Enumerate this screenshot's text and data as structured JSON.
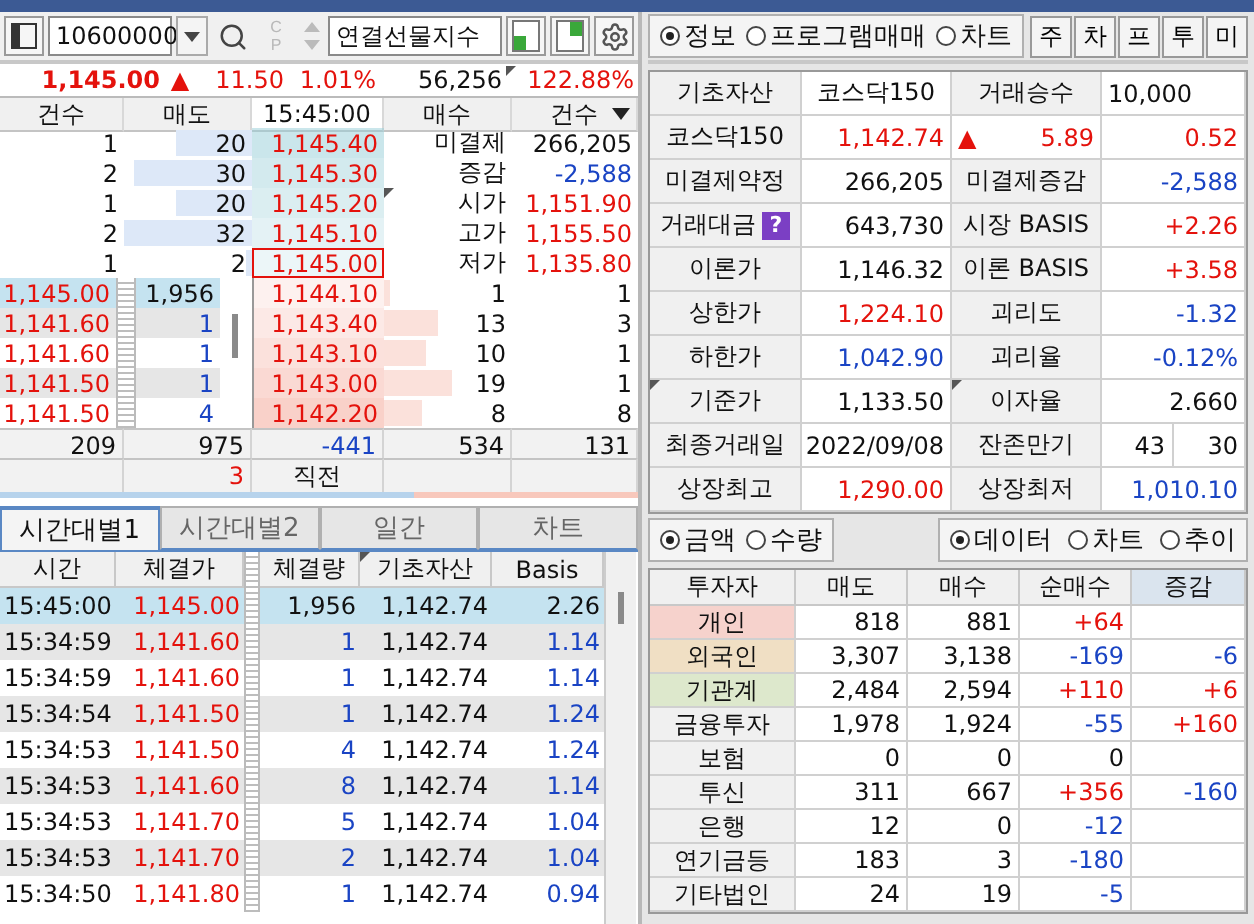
{
  "toolbar": {
    "code": "10600000",
    "cp": {
      "top": "C",
      "bottom": "P",
      "disabled": true
    },
    "name": "연결선물지수"
  },
  "mode_tabs": [
    {
      "label": "정보",
      "selected": true
    },
    {
      "label": "프로그램매매",
      "selected": false
    },
    {
      "label": "차트",
      "selected": false
    }
  ],
  "shortcuts": [
    "주",
    "차",
    "프",
    "투",
    "미"
  ],
  "quote": {
    "price": "1,145.00",
    "arrow": "▲",
    "change": "11.50",
    "rate": "1.01%",
    "color": "#e4120c",
    "volume": "56,256",
    "volume_flagged": true,
    "ratio": "122.88%"
  },
  "orderbook": {
    "columns": [
      "건수",
      "매도",
      "15:45:00",
      "매수",
      "건수"
    ],
    "asks": [
      {
        "count": "1",
        "qty": "20",
        "price": "1,145.40",
        "level": 0.6,
        "current": false
      },
      {
        "count": "2",
        "qty": "30",
        "price": "1,145.30",
        "level": 0.92,
        "current": false
      },
      {
        "count": "1",
        "qty": "20",
        "price": "1,145.20",
        "level": 0.6,
        "current": false
      },
      {
        "count": "2",
        "qty": "32",
        "price": "1,145.10",
        "level": 1,
        "current": false
      },
      {
        "count": "1",
        "qty": "2",
        "price": "1,145.00",
        "level": 0.05,
        "current": true
      }
    ],
    "stats": [
      {
        "label": "미결제",
        "value": "266,205",
        "color": "#111111",
        "flagged": false
      },
      {
        "label": "증감",
        "value": "-2,588",
        "color": "#1a44c4",
        "flagged": false
      },
      {
        "label": "시가",
        "value": "1,151.90",
        "color": "#e4120c",
        "flagged": true
      },
      {
        "label": "고가",
        "value": "1,155.50",
        "color": "#e4120c",
        "flagged": false
      },
      {
        "label": "저가",
        "value": "1,135.80",
        "color": "#e4120c",
        "flagged": false
      }
    ],
    "ticks": [
      {
        "price": "1,145.00",
        "qty": "1,956",
        "color": "#111111",
        "selected": true
      },
      {
        "price": "1,141.60",
        "qty": "1",
        "color": "#1a44c4",
        "selected": false
      },
      {
        "price": "1,141.60",
        "qty": "1",
        "color": "#1a44c4",
        "selected": false
      },
      {
        "price": "1,141.50",
        "qty": "1",
        "color": "#1a44c4",
        "selected": false
      },
      {
        "price": "1,141.50",
        "qty": "4",
        "color": "#1a44c4",
        "selected": false
      }
    ],
    "bids": [
      {
        "price": "1,144.10",
        "qty": "1",
        "count": "1",
        "level": 0.04
      },
      {
        "price": "1,143.40",
        "qty": "13",
        "count": "3",
        "level": 0.42
      },
      {
        "price": "1,143.10",
        "qty": "10",
        "count": "1",
        "level": 0.33
      },
      {
        "price": "1,143.00",
        "qty": "19",
        "count": "1",
        "level": 0.53
      },
      {
        "price": "1,142.20",
        "qty": "8",
        "count": "8",
        "level": 0.3
      }
    ],
    "totals": [
      {
        "text": "209",
        "color": "#111111"
      },
      {
        "text": "975",
        "color": "#111111"
      },
      {
        "text": "-441",
        "color": "#1a44c4"
      },
      {
        "text": "534",
        "color": "#111111"
      },
      {
        "text": "131",
        "color": "#111111"
      }
    ],
    "footer": {
      "count": "3",
      "label": "직전"
    }
  },
  "strength": {
    "level": 0.65
  },
  "info": [
    {
      "cells": [
        {
          "kind": "label",
          "text": "기초자산",
          "flagged": false
        },
        {
          "kind": "value",
          "text": "코스닥150",
          "color": "#111111"
        },
        {
          "kind": "label",
          "text": "거래승수",
          "flagged": false
        },
        {
          "kind": "value",
          "text": "10,000",
          "color": "#111111"
        }
      ]
    },
    {
      "cells": [
        {
          "kind": "label",
          "text": "코스닥150",
          "flagged": false
        },
        {
          "kind": "value",
          "text": "1,142.74",
          "color": "#e4120c"
        },
        {
          "kind": "value",
          "arrow": "▲",
          "text": "5.89",
          "color": "#e4120c"
        },
        {
          "kind": "value",
          "text": "0.52",
          "color": "#e4120c"
        }
      ]
    },
    {
      "cells": [
        {
          "kind": "label",
          "text": "미결제약정",
          "flagged": false
        },
        {
          "kind": "value",
          "text": "266,205",
          "color": "#111111"
        },
        {
          "kind": "label",
          "text": "미결제증감",
          "flagged": false
        },
        {
          "kind": "value",
          "text": "-2,588",
          "color": "#1a44c4"
        }
      ]
    },
    {
      "cells": [
        {
          "kind": "label",
          "text": "거래대금",
          "help": "?",
          "flagged": false
        },
        {
          "kind": "value",
          "text": "643,730",
          "color": "#111111"
        },
        {
          "kind": "label",
          "text": "시장 BASIS",
          "flagged": false
        },
        {
          "kind": "value",
          "text": "+2.26",
          "color": "#e4120c"
        }
      ]
    },
    {
      "cells": [
        {
          "kind": "label",
          "text": "이론가",
          "flagged": false
        },
        {
          "kind": "value",
          "text": "1,146.32",
          "color": "#111111"
        },
        {
          "kind": "label",
          "text": "이론 BASIS",
          "flagged": false
        },
        {
          "kind": "value",
          "text": "+3.58",
          "color": "#e4120c"
        }
      ]
    },
    {
      "cells": [
        {
          "kind": "label",
          "text": "상한가",
          "flagged": false
        },
        {
          "kind": "value",
          "text": "1,224.10",
          "color": "#e4120c"
        },
        {
          "kind": "label",
          "text": "괴리도",
          "flagged": false
        },
        {
          "kind": "value",
          "text": "-1.32",
          "color": "#1a44c4"
        }
      ]
    },
    {
      "cells": [
        {
          "kind": "label",
          "text": "하한가",
          "flagged": false
        },
        {
          "kind": "value",
          "text": "1,042.90",
          "color": "#1a44c4"
        },
        {
          "kind": "label",
          "text": "괴리율",
          "flagged": false
        },
        {
          "kind": "value",
          "text": "-0.12%",
          "color": "#1a44c4"
        }
      ]
    },
    {
      "cells": [
        {
          "kind": "label",
          "text": "기준가",
          "flagged": true
        },
        {
          "kind": "value",
          "text": "1,133.50",
          "color": "#111111"
        },
        {
          "kind": "label",
          "text": "이자율",
          "flagged": true
        },
        {
          "kind": "value",
          "text": "2.660",
          "color": "#111111"
        }
      ]
    },
    {
      "cells": [
        {
          "kind": "label",
          "text": "최종거래일",
          "flagged": false
        },
        {
          "kind": "value",
          "text": "2022/09/08",
          "color": "#111111"
        },
        {
          "kind": "label",
          "text": "잔존만기",
          "flagged": false
        },
        {
          "kind": "split",
          "parts": [
            "43",
            "30"
          ]
        }
      ]
    },
    {
      "cells": [
        {
          "kind": "label",
          "text": "상장최고",
          "flagged": false
        },
        {
          "kind": "value",
          "text": "1,290.00",
          "color": "#e4120c"
        },
        {
          "kind": "label",
          "text": "상장최저",
          "flagged": false
        },
        {
          "kind": "value",
          "text": "1,010.10",
          "color": "#1a44c4"
        }
      ]
    }
  ],
  "trade_tabs": [
    {
      "label": "시간대별1",
      "selected": true
    },
    {
      "label": "시간대별2",
      "selected": false
    },
    {
      "label": "일간",
      "selected": false
    },
    {
      "label": "차트",
      "selected": false
    }
  ],
  "trades": {
    "columns": [
      {
        "label": "시간",
        "flagged": false
      },
      {
        "label": "체결가",
        "flagged": false
      },
      {
        "label": "체결량",
        "flagged": false
      },
      {
        "label": "기초자산",
        "flagged": true
      },
      {
        "label": "Basis",
        "flagged": false
      }
    ],
    "rows": [
      {
        "time": "15:45:00",
        "price": "1,145.00",
        "qty": {
          "text": "1,956",
          "color": "#111111"
        },
        "base": "1,142.74",
        "basis": {
          "text": "2.26",
          "color": "#111111"
        },
        "selected": true
      },
      {
        "time": "15:34:59",
        "price": "1,141.60",
        "qty": {
          "text": "1",
          "color": "#1a44c4"
        },
        "base": "1,142.74",
        "basis": {
          "text": "1.14",
          "color": "#1a44c4"
        },
        "selected": false
      },
      {
        "time": "15:34:59",
        "price": "1,141.60",
        "qty": {
          "text": "1",
          "color": "#1a44c4"
        },
        "base": "1,142.74",
        "basis": {
          "text": "1.14",
          "color": "#1a44c4"
        },
        "selected": false
      },
      {
        "time": "15:34:54",
        "price": "1,141.50",
        "qty": {
          "text": "1",
          "color": "#1a44c4"
        },
        "base": "1,142.74",
        "basis": {
          "text": "1.24",
          "color": "#1a44c4"
        },
        "selected": false
      },
      {
        "time": "15:34:53",
        "price": "1,141.50",
        "qty": {
          "text": "4",
          "color": "#1a44c4"
        },
        "base": "1,142.74",
        "basis": {
          "text": "1.24",
          "color": "#1a44c4"
        },
        "selected": false
      },
      {
        "time": "15:34:53",
        "price": "1,141.60",
        "qty": {
          "text": "8",
          "color": "#1a44c4"
        },
        "base": "1,142.74",
        "basis": {
          "text": "1.14",
          "color": "#1a44c4"
        },
        "selected": false
      },
      {
        "time": "15:34:53",
        "price": "1,141.70",
        "qty": {
          "text": "5",
          "color": "#1a44c4"
        },
        "base": "1,142.74",
        "basis": {
          "text": "1.04",
          "color": "#1a44c4"
        },
        "selected": false
      },
      {
        "time": "15:34:53",
        "price": "1,141.70",
        "qty": {
          "text": "2",
          "color": "#1a44c4"
        },
        "base": "1,142.74",
        "basis": {
          "text": "1.04",
          "color": "#1a44c4"
        },
        "selected": false
      },
      {
        "time": "15:34:50",
        "price": "1,141.80",
        "qty": {
          "text": "1",
          "color": "#1a44c4"
        },
        "base": "1,142.74",
        "basis": {
          "text": "0.94",
          "color": "#1a44c4"
        },
        "selected": false
      }
    ]
  },
  "unit_options": [
    {
      "label": "금액",
      "selected": true
    },
    {
      "label": "수량",
      "selected": false
    }
  ],
  "view_options": [
    {
      "label": "데이터",
      "selected": true
    },
    {
      "label": "차트",
      "selected": false
    },
    {
      "label": "추이",
      "selected": false
    }
  ],
  "investors": {
    "columns": [
      {
        "label": "투자자",
        "selected": false
      },
      {
        "label": "매도",
        "selected": false
      },
      {
        "label": "매수",
        "selected": false
      },
      {
        "label": "순매수",
        "selected": false
      },
      {
        "label": "증감",
        "selected": true
      }
    ],
    "rows": [
      {
        "name": "개인",
        "color": "#f6d2cc",
        "sell": "818",
        "buy": "881",
        "net": {
          "text": "+64",
          "color": "#e4120c"
        }
      },
      {
        "name": "외국인",
        "color": "#f0dfc4",
        "sell": "3,307",
        "buy": "3,138",
        "net": {
          "text": "-169",
          "color": "#1a44c4"
        },
        "change": {
          "text": "-6",
          "color": "#1a44c4"
        }
      },
      {
        "name": "기관계",
        "color": "#dde8cc",
        "sell": "2,484",
        "buy": "2,594",
        "net": {
          "text": "+110",
          "color": "#e4120c"
        },
        "change": {
          "text": "+6",
          "color": "#e4120c"
        }
      },
      {
        "name": "금융투자",
        "color": "#f0f0f0",
        "sell": "1,978",
        "buy": "1,924",
        "net": {
          "text": "-55",
          "color": "#1a44c4"
        },
        "change": {
          "text": "+160",
          "color": "#e4120c"
        }
      },
      {
        "name": "보험",
        "color": "#f0f0f0",
        "sell": "0",
        "buy": "0",
        "net": {
          "text": "0",
          "color": "#111111"
        }
      },
      {
        "name": "투신",
        "color": "#f0f0f0",
        "sell": "311",
        "buy": "667",
        "net": {
          "text": "+356",
          "color": "#e4120c"
        },
        "change": {
          "text": "-160",
          "color": "#1a44c4"
        }
      },
      {
        "name": "은행",
        "color": "#f0f0f0",
        "sell": "12",
        "buy": "0",
        "net": {
          "text": "-12",
          "color": "#1a44c4"
        }
      },
      {
        "name": "연기금등",
        "color": "#f0f0f0",
        "sell": "183",
        "buy": "3",
        "net": {
          "text": "-180",
          "color": "#1a44c4"
        }
      },
      {
        "name": "기타법인",
        "color": "#f0f0f0",
        "sell": "24",
        "buy": "19",
        "net": {
          "text": "-5",
          "color": "#1a44c4"
        }
      }
    ]
  }
}
